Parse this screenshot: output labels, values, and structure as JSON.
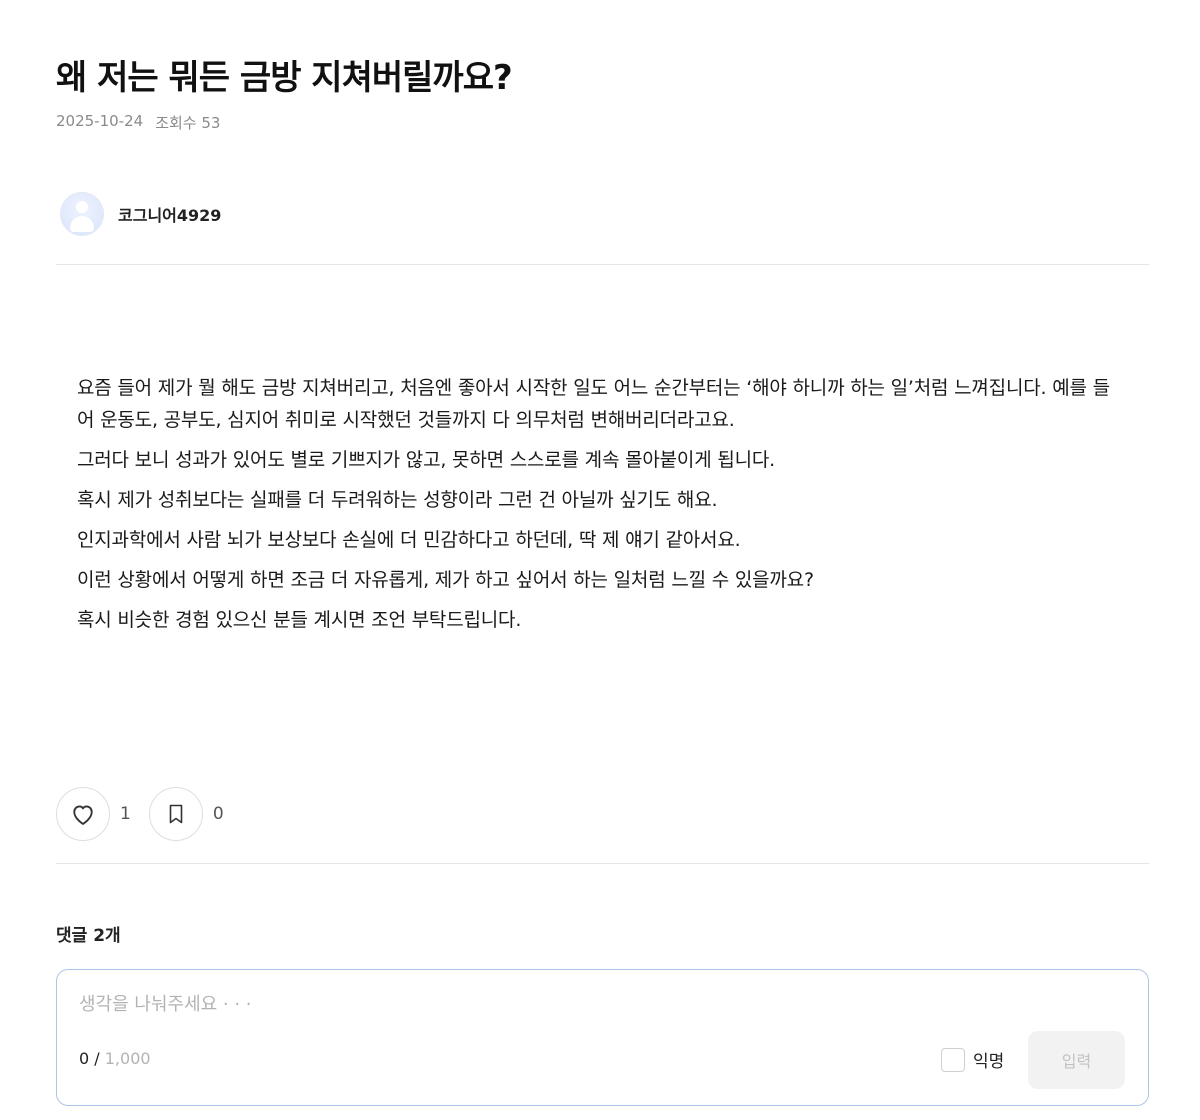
{
  "post": {
    "title": "왜 저는 뭐든 금방 지쳐버릴까요?",
    "date": "2025-10-24",
    "views": "조회수 53",
    "author": "코그니어4929",
    "body": [
      "요즘 들어 제가 뭘 해도 금방 지쳐버리고, 처음엔 좋아서 시작한 일도 어느 순간부터는 ‘해야 하니까 하는 일’처럼 느껴집니다. 예를 들어 운동도, 공부도, 심지어 취미로 시작했던 것들까지 다 의무처럼 변해버리더라고요.",
      "그러다 보니 성과가 있어도 별로 기쁘지가 않고, 못하면 스스로를 계속 몰아붙이게 됩니다.",
      "혹시 제가 성취보다는 실패를 더 두려워하는 성향이라 그런 건 아닐까 싶기도 해요.",
      "인지과학에서 사람 뇌가 보상보다 손실에 더 민감하다고 하던데, 딱 제 얘기 같아서요.",
      "이런 상황에서 어떻게 하면 조금 더 자유롭게, 제가 하고 싶어서 하는 일처럼 느낄 수 있을까요?",
      "혹시 비슷한 경험 있으신 분들 계시면 조언 부탁드립니다."
    ]
  },
  "actions": {
    "like_icon": "heart-icon",
    "like_count": "1",
    "bookmark_icon": "bookmark-icon",
    "bookmark_count": "0"
  },
  "comments": {
    "title": "댓글 2개",
    "placeholder": "생각을 나눠주세요 · · ·",
    "value": "",
    "current_count": "0 /",
    "max_count": "1,000",
    "anonymous_label": "익명",
    "submit_label": "입력"
  },
  "colors": {
    "comment_border": "#aec4e6",
    "submit_bg": "#f2f2f2",
    "muted_text": "#8a8a8a"
  }
}
